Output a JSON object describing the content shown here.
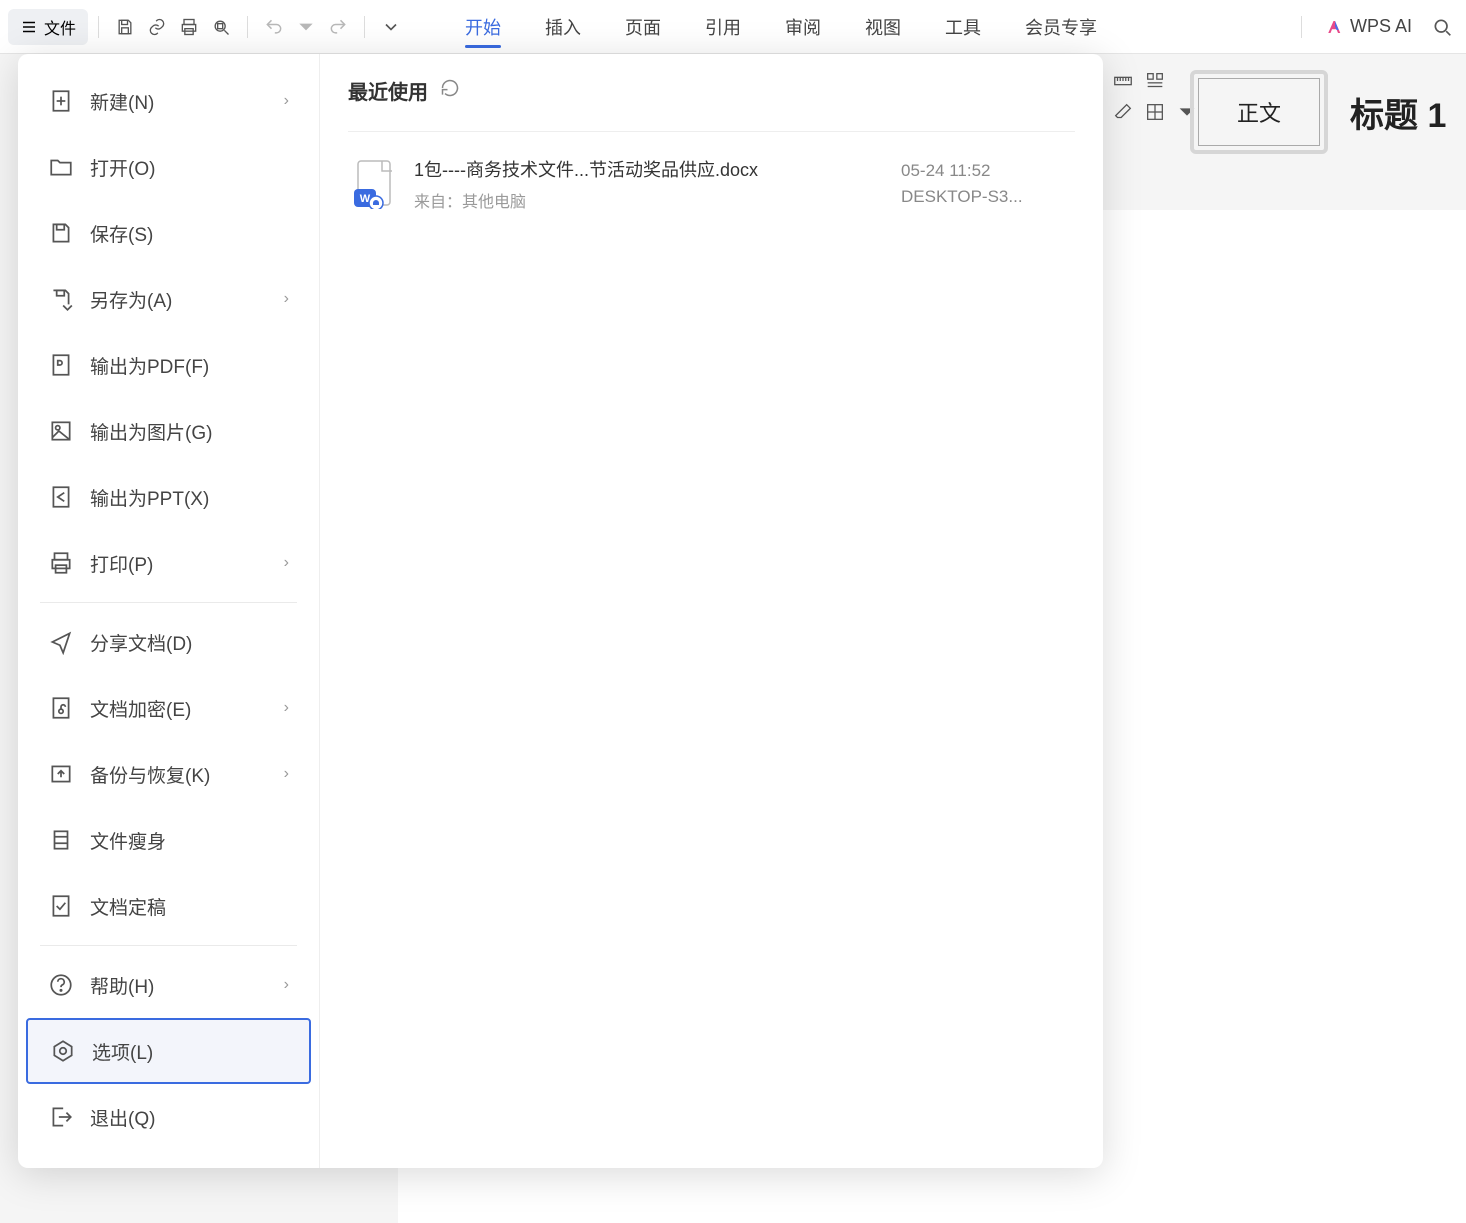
{
  "topbar": {
    "file_label": "文件",
    "wps_ai": "WPS AI"
  },
  "tabs": [
    "开始",
    "插入",
    "页面",
    "引用",
    "审阅",
    "视图",
    "工具",
    "会员专享"
  ],
  "active_tab_index": 0,
  "styles_row": {
    "normal": "正文",
    "heading1": "标题  1"
  },
  "file_menu": {
    "items": [
      {
        "label": "新建(N)",
        "icon": "new",
        "chev": true
      },
      {
        "label": "打开(O)",
        "icon": "open"
      },
      {
        "label": "保存(S)",
        "icon": "save"
      },
      {
        "label": "另存为(A)",
        "icon": "saveas",
        "chev": true
      },
      {
        "label": "输出为PDF(F)",
        "icon": "pdf"
      },
      {
        "label": "输出为图片(G)",
        "icon": "img"
      },
      {
        "label": "输出为PPT(X)",
        "icon": "ppt"
      },
      {
        "label": "打印(P)",
        "icon": "print",
        "chev": true
      }
    ],
    "items2": [
      {
        "label": "分享文档(D)",
        "icon": "share"
      },
      {
        "label": "文档加密(E)",
        "icon": "encrypt",
        "chev": true
      },
      {
        "label": "备份与恢复(K)",
        "icon": "backup",
        "chev": true
      },
      {
        "label": "文件瘦身",
        "icon": "slim"
      },
      {
        "label": "文档定稿",
        "icon": "finalize"
      }
    ],
    "items3": [
      {
        "label": "帮助(H)",
        "icon": "help",
        "chev": true
      },
      {
        "label": "选项(L)",
        "icon": "options",
        "selected": true
      },
      {
        "label": "退出(Q)",
        "icon": "exit"
      }
    ]
  },
  "recent": {
    "title": "最近使用",
    "rows": [
      {
        "name": "1包----商务技术文件...节活动奖品供应.docx",
        "sub": "来自：其他电脑",
        "time": "05-24 11:52",
        "src": "DESKTOP-S3..."
      }
    ]
  }
}
